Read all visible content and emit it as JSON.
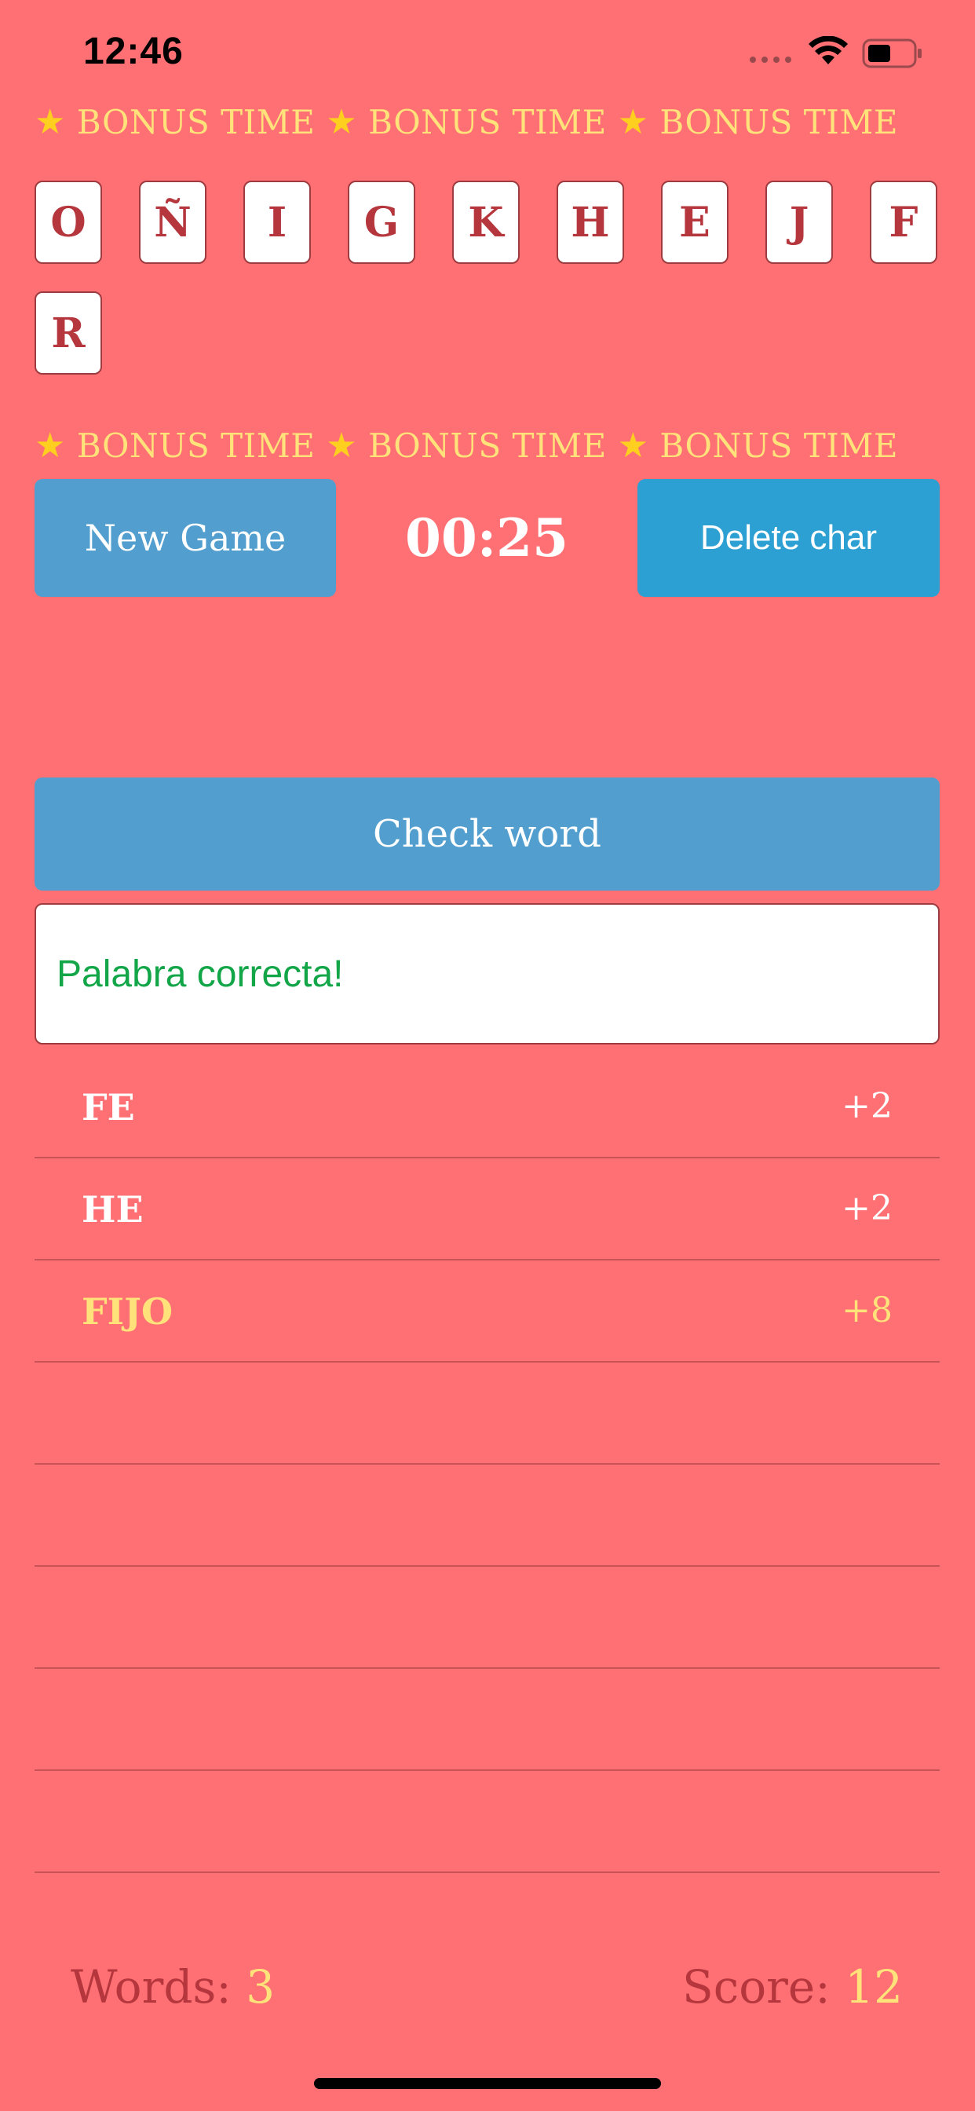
{
  "status_bar": {
    "time": "12:46"
  },
  "bonus_banner": {
    "items": [
      "BONUS TIME",
      "BONUS TIME",
      "BONUS TIME"
    ],
    "icon": "star-icon"
  },
  "tiles": [
    "O",
    "Ñ",
    "I",
    "G",
    "K",
    "H",
    "E",
    "J",
    "F",
    "R"
  ],
  "controls": {
    "new_game_label": "New Game",
    "timer": "00:25",
    "delete_label": "Delete char",
    "check_label": "Check word"
  },
  "message": "Palabra correcta!",
  "words": [
    {
      "word": "FE",
      "points": "+2",
      "highlight": false
    },
    {
      "word": "HE",
      "points": "+2",
      "highlight": false
    },
    {
      "word": "FIJO",
      "points": "+8",
      "highlight": true
    }
  ],
  "footer": {
    "words_label": "Words:",
    "words_value": "3",
    "score_label": "Score:",
    "score_value": "12"
  },
  "colors": {
    "background": "#ff7074",
    "button": "#529fcf",
    "delete_button": "#2c9fd3",
    "tile_text": "#b5373d",
    "highlight": "#ffe27a",
    "success": "#13a648"
  }
}
